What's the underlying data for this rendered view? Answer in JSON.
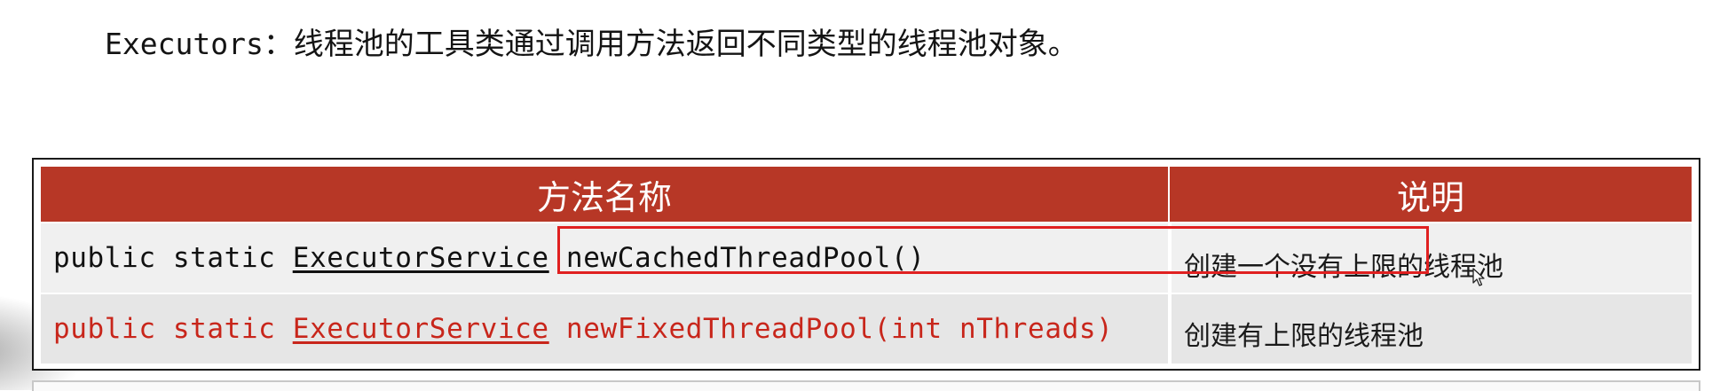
{
  "intro": {
    "code": "Executors",
    "text": "：线程池的工具类通过调用方法返回不同类型的线程池对象。"
  },
  "table": {
    "headers": [
      "方法名称",
      "说明"
    ],
    "rows": [
      {
        "modifiers": "public static ",
        "return_type": "ExecutorService",
        "method": " newCachedThreadPool()",
        "description": "创建一个没有上限的线程池"
      },
      {
        "modifiers": "public static ",
        "return_type": "ExecutorService",
        "method": " newFixedThreadPool(int nThreads)",
        "description": "创建有上限的线程池"
      }
    ]
  },
  "colors": {
    "header_bg": "#b73726",
    "highlight_border": "#e02020",
    "row2_text": "#c8261b"
  },
  "icons": {
    "cursor": "mouse-pointer-icon"
  }
}
